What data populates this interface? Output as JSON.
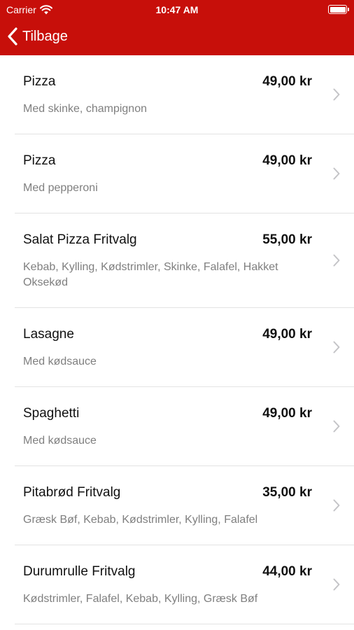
{
  "status_bar": {
    "carrier": "Carrier",
    "time": "10:47 AM"
  },
  "nav": {
    "back_label": "Tilbage"
  },
  "colors": {
    "header": "#c70f0a",
    "description": "#7f7f7f",
    "separator": "#e3e3e3"
  },
  "menu_items": [
    {
      "name": "Pizza",
      "price": "49,00 kr",
      "description": "Med skinke, champignon"
    },
    {
      "name": "Pizza",
      "price": "49,00 kr",
      "description": "Med pepperoni"
    },
    {
      "name": "Salat Pizza  Fritvalg",
      "price": "55,00 kr",
      "description": "Kebab, Kylling, Kødstrimler, Skinke, Falafel, Hakket Oksekød"
    },
    {
      "name": "Lasagne",
      "price": "49,00 kr",
      "description": "Med kødsauce"
    },
    {
      "name": "Spaghetti",
      "price": "49,00 kr",
      "description": "Med kødsauce"
    },
    {
      "name": "Pitabrød Fritvalg",
      "price": "35,00 kr",
      "description": "Græsk Bøf, Kebab, Kødstrimler, Kylling, Falafel"
    },
    {
      "name": "Durumrulle Fritvalg",
      "price": "44,00 kr",
      "description": "Kødstrimler, Falafel, Kebab, Kylling, Græsk Bøf"
    }
  ]
}
